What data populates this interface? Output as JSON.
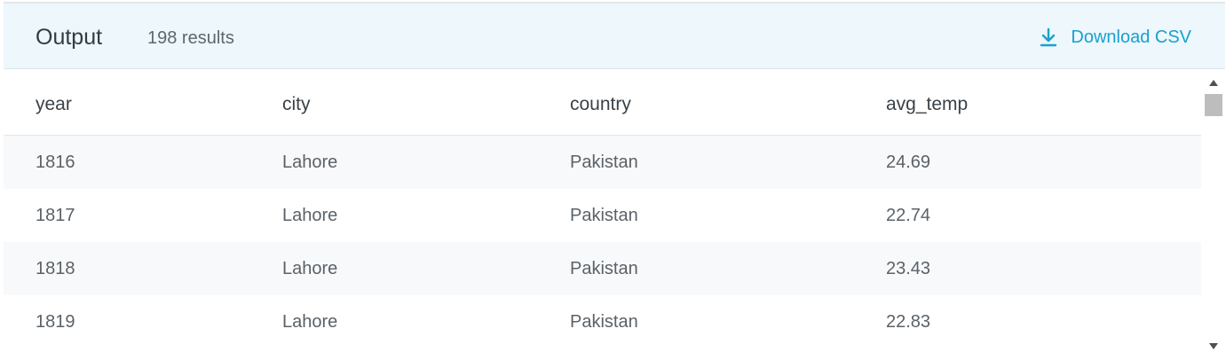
{
  "header": {
    "title": "Output",
    "result_count": "198 results",
    "download_label": "Download CSV",
    "download_icon": "download-icon"
  },
  "colors": {
    "accent": "#1aa0cf",
    "header_bg": "#edf7fc"
  },
  "table": {
    "columns": [
      "year",
      "city",
      "country",
      "avg_temp"
    ],
    "rows": [
      [
        "1816",
        "Lahore",
        "Pakistan",
        "24.69"
      ],
      [
        "1817",
        "Lahore",
        "Pakistan",
        "22.74"
      ],
      [
        "1818",
        "Lahore",
        "Pakistan",
        "23.43"
      ],
      [
        "1819",
        "Lahore",
        "Pakistan",
        "22.83"
      ]
    ]
  }
}
